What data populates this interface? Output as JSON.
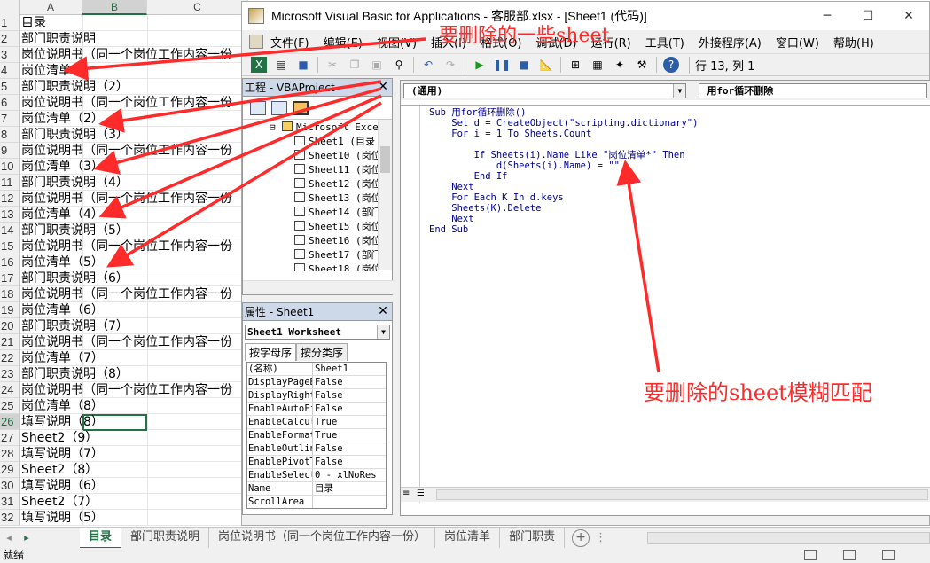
{
  "excel": {
    "columns": [
      "A",
      "B",
      "C"
    ],
    "rows": [
      {
        "num": "1",
        "a": "目录"
      },
      {
        "num": "2",
        "a": "部门职责说明"
      },
      {
        "num": "3",
        "a": "岗位说明书（同一个岗位工作内容一份"
      },
      {
        "num": "4",
        "a": "岗位清单"
      },
      {
        "num": "5",
        "a": "部门职责说明（2）"
      },
      {
        "num": "6",
        "a": "岗位说明书（同一个岗位工作内容一份"
      },
      {
        "num": "7",
        "a": "岗位清单（2）"
      },
      {
        "num": "8",
        "a": "部门职责说明（3）"
      },
      {
        "num": "9",
        "a": "岗位说明书（同一个岗位工作内容一份"
      },
      {
        "num": "10",
        "a": "岗位清单（3）"
      },
      {
        "num": "11",
        "a": "部门职责说明（4）"
      },
      {
        "num": "12",
        "a": "岗位说明书（同一个岗位工作内容一份"
      },
      {
        "num": "13",
        "a": "岗位清单（4）"
      },
      {
        "num": "14",
        "a": "部门职责说明（5）"
      },
      {
        "num": "15",
        "a": "岗位说明书（同一个岗位工作内容一份"
      },
      {
        "num": "16",
        "a": "岗位清单（5）"
      },
      {
        "num": "17",
        "a": "部门职责说明（6）"
      },
      {
        "num": "18",
        "a": "岗位说明书（同一个岗位工作内容一份"
      },
      {
        "num": "19",
        "a": "岗位清单（6）"
      },
      {
        "num": "20",
        "a": "部门职责说明（7）"
      },
      {
        "num": "21",
        "a": "岗位说明书（同一个岗位工作内容一份"
      },
      {
        "num": "22",
        "a": "岗位清单（7）"
      },
      {
        "num": "23",
        "a": "部门职责说明（8）"
      },
      {
        "num": "24",
        "a": "岗位说明书（同一个岗位工作内容一份"
      },
      {
        "num": "25",
        "a": "岗位清单（8）"
      },
      {
        "num": "26",
        "a": "填写说明（8）"
      },
      {
        "num": "27",
        "a": "Sheet2（9）"
      },
      {
        "num": "28",
        "a": "填写说明（7）"
      },
      {
        "num": "29",
        "a": "Sheet2（8）"
      },
      {
        "num": "30",
        "a": "填写说明（6）"
      },
      {
        "num": "31",
        "a": "Sheet2（7）"
      },
      {
        "num": "32",
        "a": "填写说明（5）"
      }
    ],
    "sheet_tabs": [
      "目录",
      "部门职责说明",
      "岗位说明书（同一个岗位工作内容一份）",
      "岗位清单",
      "部门职责"
    ],
    "active_tab": "目录",
    "status": "就绪"
  },
  "vba": {
    "title": "Microsoft Visual Basic for Applications - 客服部.xlsx - [Sheet1 (代码)]",
    "menu": [
      "文件(F)",
      "编辑(E)",
      "视图(V)",
      "插入(I)",
      "格式(O)",
      "调试(D)",
      "运行(R)",
      "工具(T)",
      "外接程序(A)",
      "窗口(W)",
      "帮助(H)"
    ],
    "position": "行 13, 列 1",
    "project_pane": {
      "title": "工程 - VBAProject",
      "folder": "Microsoft Excel",
      "items": [
        "Sheet1 (目录",
        "Sheet10 (岗位",
        "Sheet11 (岗位",
        "Sheet12 (岗位",
        "Sheet13 (岗位",
        "Sheet14 (部门",
        "Sheet15 (岗位",
        "Sheet16 (岗位",
        "Sheet17 (部门",
        "Sheet18 (岗位"
      ]
    },
    "properties_pane": {
      "title": "属性 - Sheet1",
      "object": "Sheet1 Worksheet",
      "tabs": [
        "按字母序",
        "按分类序"
      ],
      "rows": [
        {
          "name": "(名称)",
          "value": "Sheet1"
        },
        {
          "name": "DisplayPageB",
          "value": "False"
        },
        {
          "name": "DisplayRight",
          "value": "False"
        },
        {
          "name": "EnableAutoFi",
          "value": "False"
        },
        {
          "name": "EnableCalcul",
          "value": "True"
        },
        {
          "name": "EnableFormat",
          "value": "True"
        },
        {
          "name": "EnableOutlin",
          "value": "False"
        },
        {
          "name": "EnablePivotT",
          "value": "False"
        },
        {
          "name": "EnableSelect",
          "value": "0 - xlNoRes"
        },
        {
          "name": "Name",
          "value": "目录"
        },
        {
          "name": "ScrollArea",
          "value": ""
        }
      ]
    },
    "code": {
      "combo_left": "(通用)",
      "combo_right": "用for循环删除",
      "lines": [
        "Sub 用for循环删除()",
        "    Set d = CreateObject(\"scripting.dictionary\")",
        "    For i = 1 To Sheets.Count",
        "",
        "        If Sheets(i).Name Like \"岗位清单*\" Then",
        "            d(Sheets(i).Name) = \"\"",
        "        End If",
        "    Next",
        "    For Each K In d.keys",
        "    Sheets(K).Delete",
        "    Next",
        "End Sub"
      ]
    }
  },
  "annotations": {
    "top_label": "要删除的一些sheet",
    "right_label": "要删除的sheet模糊匹配",
    "color": "#ff2a2a"
  }
}
